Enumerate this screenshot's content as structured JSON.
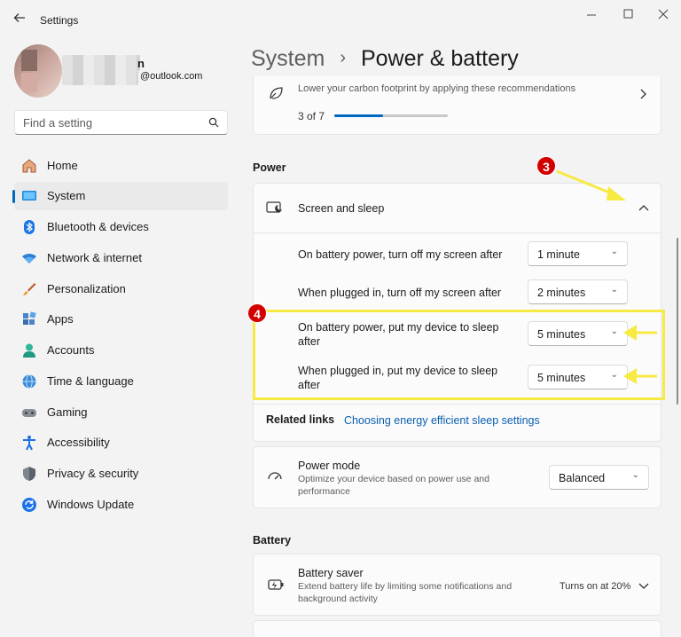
{
  "window": {
    "title": "Settings",
    "back_icon": "back-arrow-icon",
    "min_icon": "minimize-icon",
    "max_icon": "maximize-icon",
    "close_icon": "close-icon"
  },
  "user": {
    "email": "@outlook.com",
    "name_suffix": "n"
  },
  "search": {
    "placeholder": "Find a setting"
  },
  "sidebar": {
    "items": [
      {
        "label": "Home",
        "icon": "home-icon",
        "selected": false
      },
      {
        "label": "System",
        "icon": "system-icon",
        "selected": true
      },
      {
        "label": "Bluetooth & devices",
        "icon": "bluetooth-icon",
        "selected": false
      },
      {
        "label": "Network & internet",
        "icon": "wifi-icon",
        "selected": false
      },
      {
        "label": "Personalization",
        "icon": "brush-icon",
        "selected": false
      },
      {
        "label": "Apps",
        "icon": "apps-icon",
        "selected": false
      },
      {
        "label": "Accounts",
        "icon": "accounts-icon",
        "selected": false
      },
      {
        "label": "Time & language",
        "icon": "globe-icon",
        "selected": false
      },
      {
        "label": "Gaming",
        "icon": "gamepad-icon",
        "selected": false
      },
      {
        "label": "Accessibility",
        "icon": "accessibility-icon",
        "selected": false
      },
      {
        "label": "Privacy & security",
        "icon": "shield-icon",
        "selected": false
      },
      {
        "label": "Windows Update",
        "icon": "update-icon",
        "selected": false
      }
    ]
  },
  "breadcrumb": {
    "parent": "System",
    "separator": "›",
    "current": "Power & battery"
  },
  "recommendations": {
    "text": "Lower your carbon footprint by applying these recommendations",
    "progress_text": "3 of 7",
    "progress": 0.43
  },
  "power": {
    "section": "Power",
    "screen_sleep": {
      "title": "Screen and sleep",
      "rows": [
        {
          "label": "On battery power, turn off my screen after",
          "value": "1 minute"
        },
        {
          "label": "When plugged in, turn off my screen after",
          "value": "2 minutes"
        },
        {
          "label": "On battery power, put my device to sleep after",
          "value": "5 minutes"
        },
        {
          "label": "When plugged in, put my device to sleep after",
          "value": "5 minutes"
        }
      ]
    },
    "related": {
      "label": "Related links",
      "link": "Choosing energy efficient sleep settings"
    },
    "power_mode": {
      "title": "Power mode",
      "desc": "Optimize your device based on power use and performance",
      "value": "Balanced"
    }
  },
  "battery": {
    "section": "Battery",
    "saver": {
      "title": "Battery saver",
      "desc": "Extend battery life by limiting some notifications and background activity",
      "status": "Turns on at 20%"
    }
  },
  "annotations": {
    "step3": "3",
    "step4": "4",
    "highlight_color": "#f7ea43",
    "badge_color": "#d40000"
  }
}
